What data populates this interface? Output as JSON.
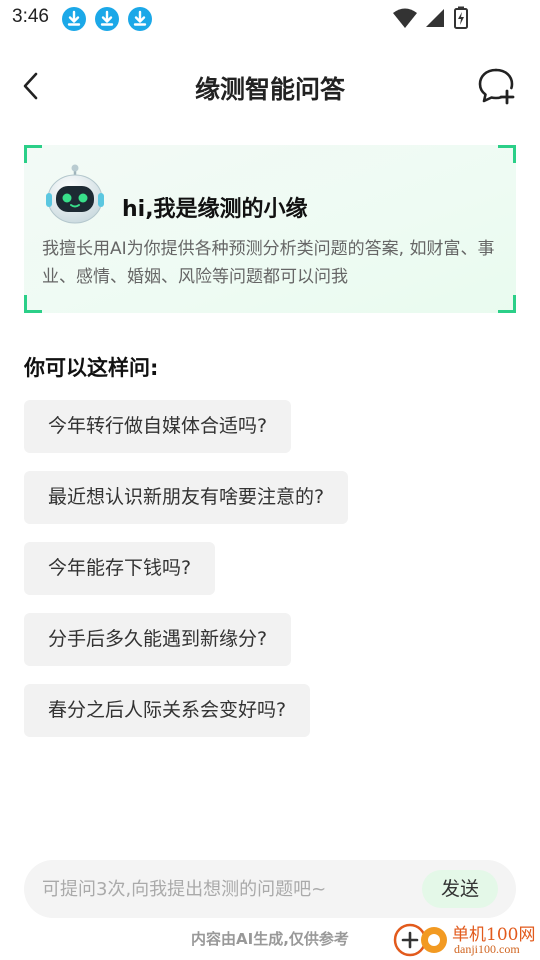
{
  "status_bar": {
    "time": "3:46",
    "notification_icons": [
      "download-icon",
      "download-icon",
      "download-icon"
    ],
    "system_icons": [
      "wifi-icon",
      "cellular-signal-icon",
      "battery-charging-icon"
    ]
  },
  "header": {
    "title": "缘测智能问答",
    "back_icon": "chevron-left-icon",
    "new_chat_icon": "chat-bubble-plus-icon"
  },
  "intro": {
    "greeting": "hi,我是缘测的小缘",
    "description": "我擅长用AI为你提供各种预测分析类问题的答案, 如财富、事业、感情、婚姻、风险等问题都可以问我",
    "avatar_icon": "robot-icon",
    "accent_color": "#2bcf88"
  },
  "suggestions": {
    "title": "你可以这样问:",
    "items": [
      "今年转行做自媒体合适吗?",
      "最近想认识新朋友有啥要注意的?",
      "今年能存下钱吗?",
      "分手后多久能遇到新缘分?",
      "春分之后人际关系会变好吗?"
    ]
  },
  "input": {
    "placeholder": "可提问3次,向我提出想测的问题吧~",
    "send_label": "发送"
  },
  "disclaimer": "内容由AI生成,仅供参考",
  "watermark": {
    "brand": "单机100网",
    "domain": "danji100.com"
  }
}
